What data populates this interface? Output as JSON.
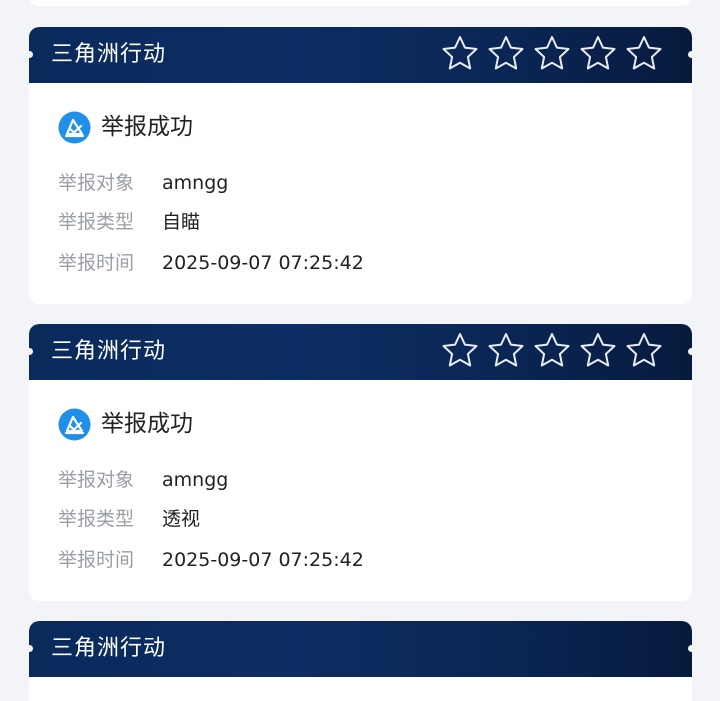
{
  "cards": [
    {
      "game_title": "三角洲行动",
      "rating": {
        "filled": 0,
        "max": 5
      },
      "status": "举报成功",
      "rows": [
        {
          "label": "举报对象",
          "value": "amngg"
        },
        {
          "label": "举报类型",
          "value": "自瞄"
        },
        {
          "label": "举报时间",
          "value": "2025-09-07 07:25:42"
        }
      ]
    },
    {
      "game_title": "三角洲行动",
      "rating": {
        "filled": 0,
        "max": 5
      },
      "status": "举报成功",
      "rows": [
        {
          "label": "举报对象",
          "value": "amngg"
        },
        {
          "label": "举报类型",
          "value": "透视"
        },
        {
          "label": "举报时间",
          "value": "2025-09-07 07:25:42"
        }
      ]
    },
    {
      "game_title": "三角洲行动"
    }
  ],
  "icons": {
    "star": "star-outline-icon",
    "status": "report-success-icon"
  },
  "colors": {
    "header_bg": "#0c2d63",
    "status_icon": "#1f8fe8",
    "label": "#9a9ea6",
    "value": "#222222",
    "page_bg": "#f2f4f7"
  }
}
